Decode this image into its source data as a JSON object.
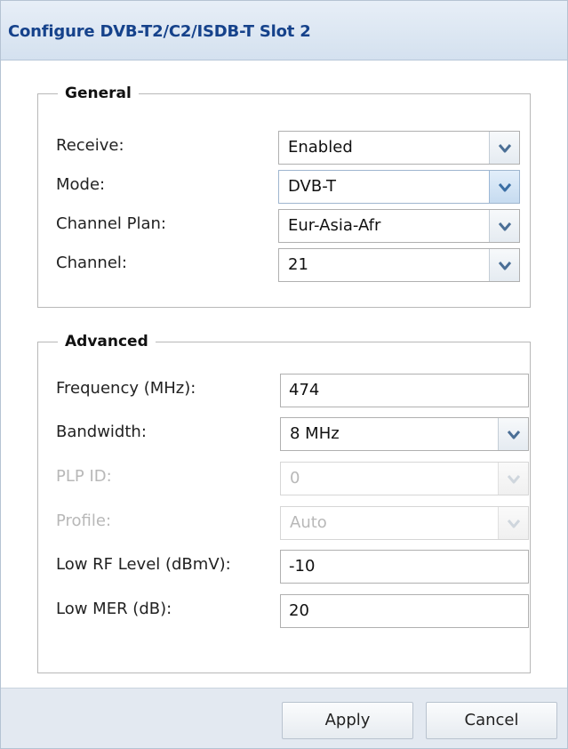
{
  "dialog": {
    "title": "Configure DVB-T2/C2/ISDB-T Slot 2"
  },
  "general": {
    "legend": "General",
    "receive": {
      "label": "Receive:",
      "value": "Enabled"
    },
    "mode": {
      "label": "Mode:",
      "value": "DVB-T"
    },
    "channel_plan": {
      "label": "Channel Plan:",
      "value": "Eur-Asia-Afr"
    },
    "channel": {
      "label": "Channel:",
      "value": "21"
    }
  },
  "advanced": {
    "legend": "Advanced",
    "frequency": {
      "label": "Frequency (MHz):",
      "value": "474"
    },
    "bandwidth": {
      "label": "Bandwidth:",
      "value": "8 MHz"
    },
    "plp_id": {
      "label": "PLP ID:",
      "value": "0",
      "disabled": true
    },
    "profile": {
      "label": "Profile:",
      "value": "Auto",
      "disabled": true
    },
    "low_rf_level": {
      "label": "Low RF Level (dBmV):",
      "value": "-10"
    },
    "low_mer": {
      "label": "Low MER (dB):",
      "value": "20"
    }
  },
  "footer": {
    "apply_label": "Apply",
    "cancel_label": "Cancel"
  },
  "icons": {
    "dropdown": "chevron-down-icon"
  },
  "colors": {
    "title_text": "#15428b",
    "titlebar_bg": "#dce6f2",
    "disabled_text": "#b8b8b8",
    "active_trigger": "#c6dbf0"
  }
}
